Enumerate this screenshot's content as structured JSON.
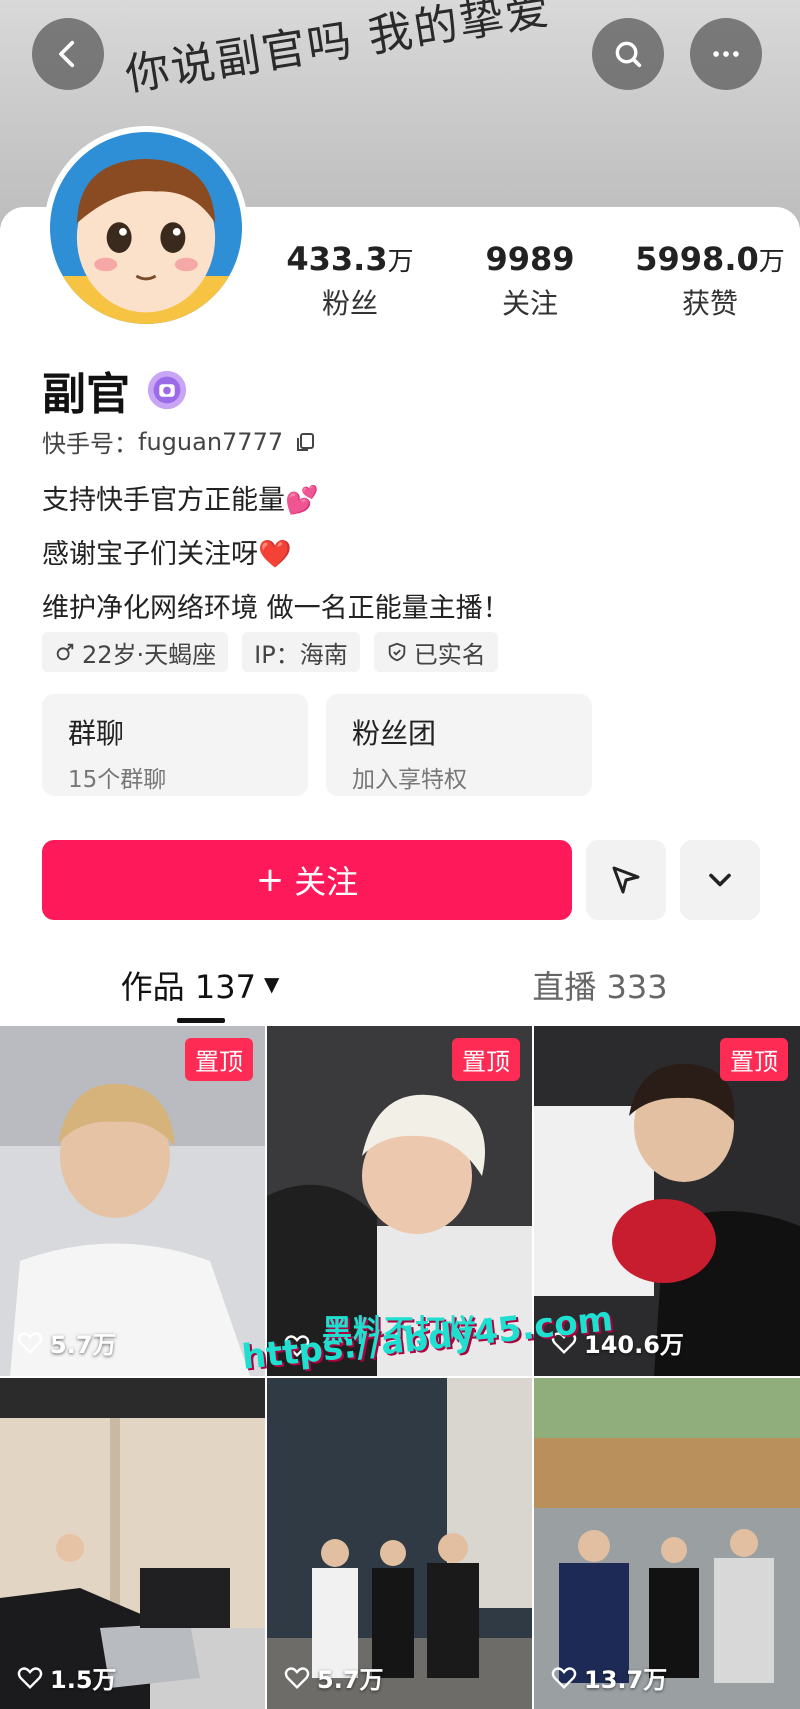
{
  "cover": {
    "text": "你说副官吗 我的挚爱"
  },
  "profile": {
    "stats": [
      {
        "value": "433.3",
        "unit": "万",
        "label": "粉丝"
      },
      {
        "value": "9989",
        "unit": "",
        "label": "关注"
      },
      {
        "value": "5998.0",
        "unit": "万",
        "label": "获赞"
      }
    ],
    "name": "副官",
    "handle_label": "快手号：",
    "handle": "fuguan7777",
    "bio": [
      "支持快手官方正能量💕",
      "感谢宝子们关注呀❤️",
      "维护净化网络环境 做一名正能量主播！"
    ],
    "tags": [
      "22岁·天蝎座",
      "IP：海南",
      "已实名"
    ]
  },
  "cards": [
    {
      "title": "群聊",
      "sub": "15个群聊"
    },
    {
      "title": "粉丝团",
      "sub": "加入享特权"
    }
  ],
  "actions": {
    "follow": "关注"
  },
  "tabs": [
    {
      "label": "作品 137"
    },
    {
      "label": "直播 333"
    }
  ],
  "videos": [
    {
      "pinned": "置顶",
      "likes": "5.7万"
    },
    {
      "pinned": "置顶",
      "likes": ""
    },
    {
      "pinned": "置顶",
      "likes": "140.6万"
    },
    {
      "pinned": "",
      "likes": "1.5万"
    },
    {
      "pinned": "",
      "likes": "5.7万"
    },
    {
      "pinned": "",
      "likes": "13.7万"
    }
  ],
  "watermark": {
    "line1": "黑料不打烊",
    "line2": "https://abdy45.com"
  },
  "colors": {
    "accent": "#fe1a5a",
    "pin": "#fe2c55"
  }
}
